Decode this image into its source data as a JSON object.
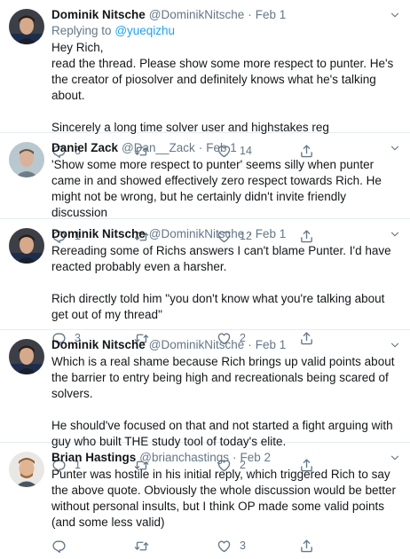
{
  "tweets": [
    {
      "name": "Dominik Nitsche",
      "handle": "@DominikNitsche",
      "date": "Feb 1",
      "replying_label": "Replying to",
      "replying_to": "@yueqizhu",
      "text": "Hey Rich,\nread the thread. Please show some more respect to punter. He's the creator of piosolver and definitely knows what he's talking about.\n\nSincerely a long time solver user and highstakes reg",
      "replies": "6",
      "retweets": "",
      "likes": "14"
    },
    {
      "name": "Daniel Zack",
      "handle": "@Dan__Zack",
      "date": "Feb 1",
      "text": "'Show some more respect to punter' seems silly when punter came in and showed effectively zero respect towards Rich. He might not be wrong, but he certainly didn't invite friendly discussion",
      "replies": "1",
      "retweets": "",
      "likes": "12"
    },
    {
      "name": "Dominik Nitsche",
      "handle": "@DominikNitsche",
      "date": "Feb 1",
      "text": "Rereading some of Richs answers I can't blame Punter. I'd have reacted probably even a harsher.\n\nRich directly  told him \"you don't know what you're talking about get out of my thread\"",
      "replies": "3",
      "retweets": "",
      "likes": "2"
    },
    {
      "name": "Dominik Nitsche",
      "handle": "@DominikNitsche",
      "date": "Feb 1",
      "text": "Which is a real shame because Rich brings up valid points about the barrier to entry being high and recreationals being scared of solvers.\n\nHe should've focused on that and not started a fight arguing with guy who built THE study tool of today's elite.",
      "replies": "1",
      "retweets": "",
      "likes": "2"
    },
    {
      "name": "Brian Hastings",
      "handle": "@brianchastings",
      "date": "Feb 2",
      "text": "Punter was hostile in his initial reply, which triggered Rich to say the above quote. Obviously the whole discussion would be better without personal insults, but I think OP made some valid points (and some less valid)",
      "replies": "",
      "retweets": "",
      "likes": "3"
    }
  ],
  "separator": "·",
  "icons": [
    "reply-icon",
    "retweet-icon",
    "like-icon",
    "share-icon",
    "caret-down-icon"
  ],
  "colors": {
    "text": "#14171a",
    "muted": "#657786",
    "link": "#1da1f2",
    "border": "#e6ecf0"
  }
}
